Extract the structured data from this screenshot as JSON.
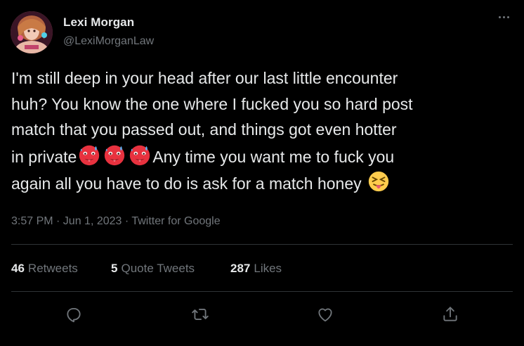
{
  "author": {
    "name": "Lexi Morgan",
    "handle": "@LexiMorganLaw"
  },
  "tweet": {
    "line1": "I'm still deep in your head after our last little encounter",
    "line2": "huh? You know the one where I fucked you so hard post",
    "line3": "match that you passed out, and things got even hotter",
    "line4_pre": "in private",
    "line4_post": "Any time you want me to fuck you",
    "line5": "again all you have to do is ask for a match honey",
    "emoji_hot": "hot-face-emoji",
    "emoji_tongue": "squinting-face-with-tongue-emoji"
  },
  "meta": {
    "text": "3:57 PM · Jun 1, 2023 · Twitter for Google"
  },
  "stats": {
    "retweets_count": "46",
    "retweets_label": "Retweets",
    "quotes_count": "5",
    "quotes_label": "Quote Tweets",
    "likes_count": "287",
    "likes_label": "Likes"
  },
  "actions": {
    "reply_icon": "reply-icon",
    "retweet_icon": "retweet-icon",
    "like_icon": "like-icon",
    "share_icon": "share-icon"
  },
  "colors": {
    "background": "#000000",
    "text_primary": "#e7e9ea",
    "text_secondary": "#71767b",
    "divider": "#2f3336"
  }
}
